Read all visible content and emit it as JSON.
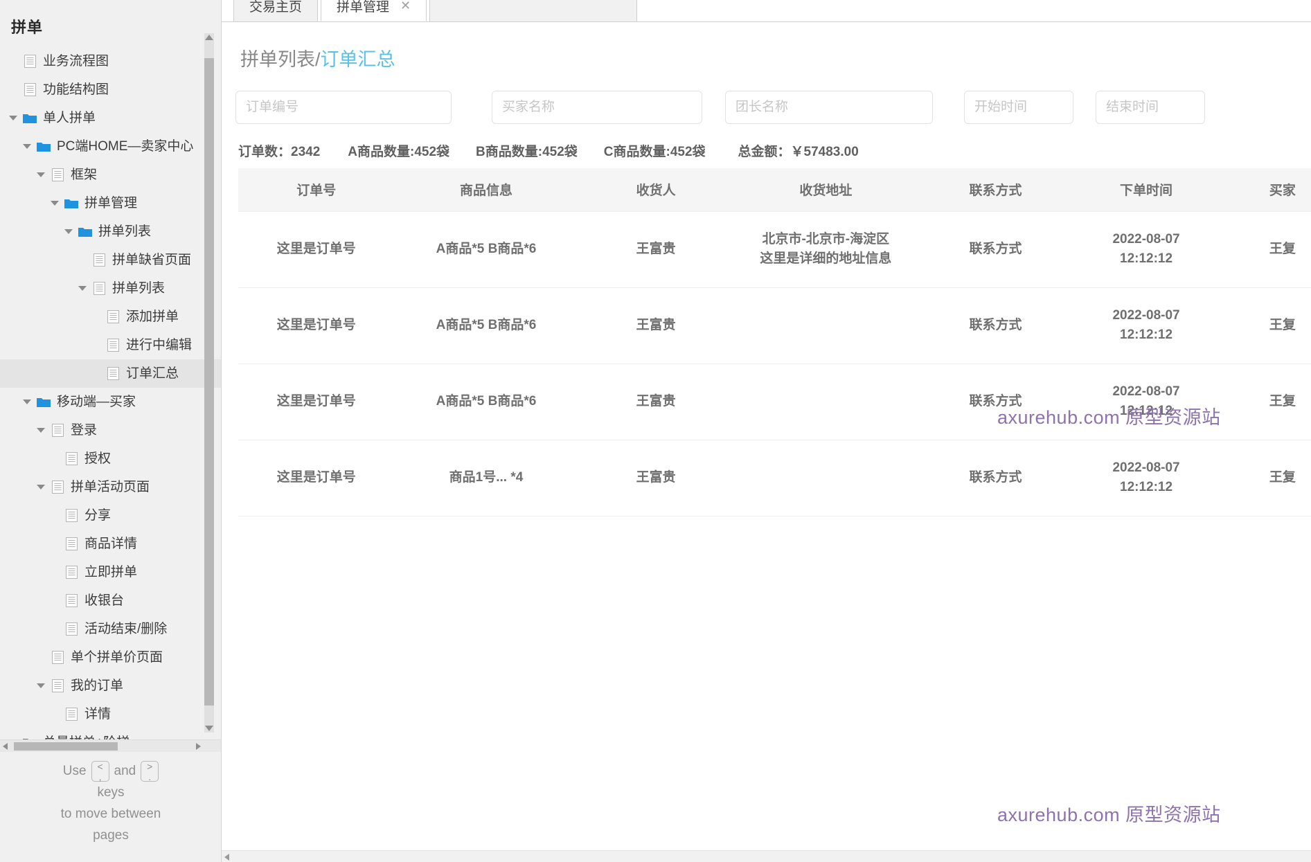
{
  "sidebar": {
    "title": "拼单",
    "tree": [
      {
        "label": "业务流程图",
        "indent": 1,
        "icon": "page-icon",
        "arrow": "none",
        "selected": false
      },
      {
        "label": "功能结构图",
        "indent": 1,
        "icon": "page-icon",
        "arrow": "none",
        "selected": false
      },
      {
        "label": "单人拼单",
        "indent": 1,
        "icon": "folder-icon",
        "arrow": "open",
        "selected": false
      },
      {
        "label": "PC端HOME—卖家中心",
        "indent": 2,
        "icon": "folder-icon",
        "arrow": "open",
        "selected": false
      },
      {
        "label": "框架",
        "indent": 3,
        "icon": "page-icon",
        "arrow": "open",
        "selected": false
      },
      {
        "label": "拼单管理",
        "indent": 4,
        "icon": "folder-icon",
        "arrow": "open",
        "selected": false
      },
      {
        "label": "拼单列表",
        "indent": 5,
        "icon": "folder-icon",
        "arrow": "open",
        "selected": false
      },
      {
        "label": "拼单缺省页面",
        "indent": 6,
        "icon": "page-icon",
        "arrow": "none",
        "selected": false
      },
      {
        "label": "拼单列表",
        "indent": 6,
        "icon": "page-icon",
        "arrow": "open",
        "selected": false
      },
      {
        "label": "添加拼单",
        "indent": 7,
        "icon": "page-icon",
        "arrow": "none",
        "selected": false
      },
      {
        "label": "进行中编辑",
        "indent": 7,
        "icon": "page-icon",
        "arrow": "none",
        "selected": false
      },
      {
        "label": "订单汇总",
        "indent": 7,
        "icon": "page-icon",
        "arrow": "none",
        "selected": true
      },
      {
        "label": "移动端—买家",
        "indent": 2,
        "icon": "folder-icon",
        "arrow": "open",
        "selected": false
      },
      {
        "label": "登录",
        "indent": 3,
        "icon": "page-icon",
        "arrow": "open",
        "selected": false
      },
      {
        "label": "授权",
        "indent": 4,
        "icon": "page-icon",
        "arrow": "none",
        "selected": false
      },
      {
        "label": "拼单活动页面",
        "indent": 3,
        "icon": "page-icon",
        "arrow": "open",
        "selected": false
      },
      {
        "label": "分享",
        "indent": 4,
        "icon": "page-icon",
        "arrow": "none",
        "selected": false
      },
      {
        "label": "商品详情",
        "indent": 4,
        "icon": "page-icon",
        "arrow": "none",
        "selected": false
      },
      {
        "label": "立即拼单",
        "indent": 4,
        "icon": "page-icon",
        "arrow": "none",
        "selected": false
      },
      {
        "label": "收银台",
        "indent": 4,
        "icon": "page-icon",
        "arrow": "none",
        "selected": false
      },
      {
        "label": "活动结束/删除",
        "indent": 4,
        "icon": "page-icon",
        "arrow": "none",
        "selected": false
      },
      {
        "label": "单个拼单价页面",
        "indent": 3,
        "icon": "page-icon",
        "arrow": "none",
        "selected": false
      },
      {
        "label": "我的订单",
        "indent": 3,
        "icon": "page-icon",
        "arrow": "open",
        "selected": false
      },
      {
        "label": "详情",
        "indent": 4,
        "icon": "page-icon",
        "arrow": "none",
        "selected": false
      },
      {
        "label": "总量拼单+阶梯",
        "indent": 1,
        "icon": "folder-icon",
        "arrow": "none",
        "selected": false
      }
    ],
    "hint": {
      "use": "Use",
      "and": "and",
      "key_prev_top": "<",
      "key_prev_bottom": ",",
      "key_next_top": ">",
      "key_next_bottom": ".",
      "keys": "keys",
      "line3": "to move between",
      "line4": "pages"
    }
  },
  "tabs": [
    {
      "label": "交易主页",
      "active": false,
      "closable": false
    },
    {
      "label": "拼单管理",
      "active": true,
      "closable": true,
      "close_glyph": "✕"
    }
  ],
  "breadcrumb": {
    "parent": "拼单列表",
    "separator": "/",
    "current": "订单汇总"
  },
  "filters": [
    {
      "name": "order-no",
      "placeholder": "订单编号",
      "value": ""
    },
    {
      "name": "buyer-name",
      "placeholder": "买家名称",
      "value": ""
    },
    {
      "name": "leader-name",
      "placeholder": "团长名称",
      "value": ""
    },
    {
      "name": "start-time",
      "placeholder": "开始时间",
      "value": ""
    },
    {
      "name": "end-time",
      "placeholder": "结束时间",
      "value": ""
    }
  ],
  "stats": {
    "order_count": "订单数：2342",
    "product_a": "A商品数量:452袋",
    "product_b": "B商品数量:452袋",
    "product_c": "C商品数量:452袋",
    "total_amount": "总金额：￥57483.00"
  },
  "table": {
    "headers": [
      "订单号",
      "商品信息",
      "收货人",
      "收货地址",
      "联系方式",
      "下单时间",
      "买家"
    ],
    "rows": [
      {
        "order_no": "这里是订单号",
        "goods": "A商品*5 B商品*6",
        "consignee": "王富贵",
        "address_line1": "北京市-北京市-海淀区",
        "address_line2": "这里是详细的地址信息",
        "contact": "联系方式",
        "time_line1": "2022-08-07",
        "time_line2": "12:12:12",
        "buyer": "王复"
      },
      {
        "order_no": "这里是订单号",
        "goods": "A商品*5 B商品*6",
        "consignee": "王富贵",
        "address_line1": "",
        "address_line2": "",
        "contact": "联系方式",
        "time_line1": "2022-08-07",
        "time_line2": "12:12:12",
        "buyer": "王复"
      },
      {
        "order_no": "这里是订单号",
        "goods": "A商品*5 B商品*6",
        "consignee": "王富贵",
        "address_line1": "",
        "address_line2": "",
        "contact": "联系方式",
        "time_line1": "2022-08-07",
        "time_line2": "12:12:12",
        "buyer": "王复"
      },
      {
        "order_no": "这里是订单号",
        "goods": "商品1号... *4",
        "consignee": "王富贵",
        "address_line1": "",
        "address_line2": "",
        "contact": "联系方式",
        "time_line1": "2022-08-07",
        "time_line2": "12:12:12",
        "buyer": "王复"
      }
    ]
  },
  "watermark": {
    "text": "axurehub.com 原型资源站",
    "color": "#8d73ae"
  },
  "colors": {
    "accent": "#57c1e8",
    "folder": "#1f92e0",
    "sidebar_bg": "#f0f0f0",
    "table_header_bg": "#f5f5f5"
  }
}
